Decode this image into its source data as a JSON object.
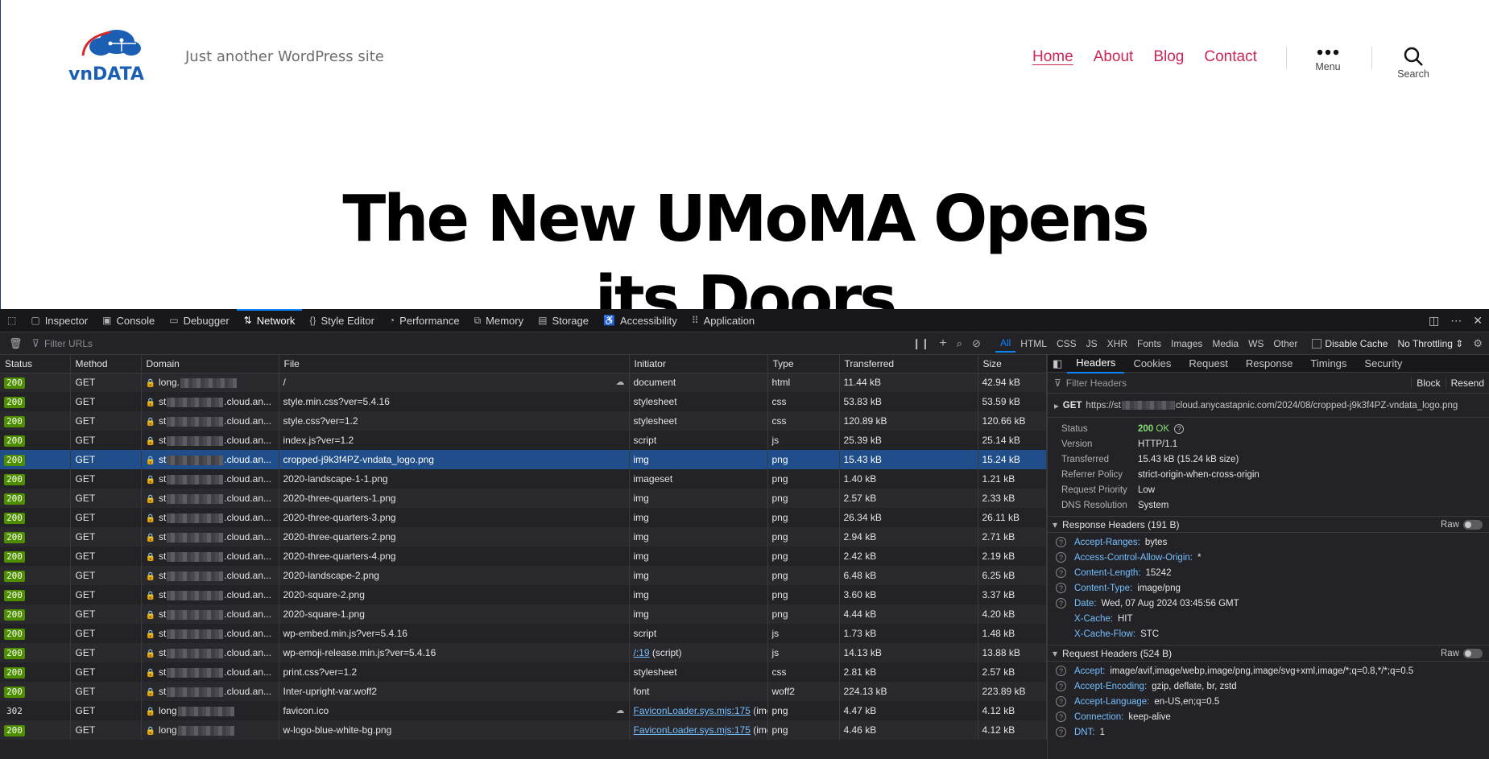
{
  "site": {
    "tagline": "Just another WordPress site",
    "logo_text": "vnDATA",
    "nav": [
      "Home",
      "About",
      "Blog",
      "Contact"
    ],
    "menu_label": "Menu",
    "search_label": "Search",
    "headline": "The New UMoMA Opens its Doors",
    "colors": {
      "accent": "#cd2653",
      "logo_blue": "#1a5fb4",
      "logo_red": "#d42a2a"
    }
  },
  "devtools": {
    "tabs": [
      {
        "label": "Inspector",
        "icon": "inspector-icon"
      },
      {
        "label": "Console",
        "icon": "console-icon"
      },
      {
        "label": "Debugger",
        "icon": "debugger-icon"
      },
      {
        "label": "Network",
        "icon": "network-icon"
      },
      {
        "label": "Style Editor",
        "icon": "style-editor-icon"
      },
      {
        "label": "Performance",
        "icon": "performance-icon"
      },
      {
        "label": "Memory",
        "icon": "memory-icon"
      },
      {
        "label": "Storage",
        "icon": "storage-icon"
      },
      {
        "label": "Accessibility",
        "icon": "accessibility-icon"
      },
      {
        "label": "Application",
        "icon": "application-icon"
      }
    ],
    "filter_placeholder": "Filter URLs",
    "type_filters": [
      "All",
      "HTML",
      "CSS",
      "JS",
      "XHR",
      "Fonts",
      "Images",
      "Media",
      "WS",
      "Other"
    ],
    "disable_cache": "Disable Cache",
    "throttling": "No Throttling ⇕",
    "columns": [
      "Status",
      "Method",
      "Domain",
      "File",
      "Initiator",
      "Type",
      "Transferred",
      "Size"
    ],
    "rows": [
      {
        "status": "200",
        "method": "GET",
        "domain_pre": "long.",
        "domain_post": "",
        "file": "/",
        "initiator": "document",
        "type": "html",
        "transferred": "11.44 kB",
        "size": "42.94 kB"
      },
      {
        "status": "200",
        "method": "GET",
        "domain_pre": "st",
        "domain_post": ".cloud.an...",
        "file": "style.min.css?ver=5.4.16",
        "initiator": "stylesheet",
        "type": "css",
        "transferred": "53.83 kB",
        "size": "53.59 kB"
      },
      {
        "status": "200",
        "method": "GET",
        "domain_pre": "st",
        "domain_post": ".cloud.an...",
        "file": "style.css?ver=1.2",
        "initiator": "stylesheet",
        "type": "css",
        "transferred": "120.89 kB",
        "size": "120.66 kB"
      },
      {
        "status": "200",
        "method": "GET",
        "domain_pre": "st",
        "domain_post": ".cloud.an...",
        "file": "index.js?ver=1.2",
        "initiator": "script",
        "type": "js",
        "transferred": "25.39 kB",
        "size": "25.14 kB"
      },
      {
        "status": "200",
        "method": "GET",
        "domain_pre": "st",
        "domain_post": ".cloud.an...",
        "file": "cropped-j9k3f4PZ-vndata_logo.png",
        "initiator": "img",
        "type": "png",
        "transferred": "15.43 kB",
        "size": "15.24 kB"
      },
      {
        "status": "200",
        "method": "GET",
        "domain_pre": "st",
        "domain_post": ".cloud.an...",
        "file": "2020-landscape-1-1.png",
        "initiator": "imageset",
        "type": "png",
        "transferred": "1.40 kB",
        "size": "1.21 kB"
      },
      {
        "status": "200",
        "method": "GET",
        "domain_pre": "st",
        "domain_post": ".cloud.an...",
        "file": "2020-three-quarters-1.png",
        "initiator": "img",
        "type": "png",
        "transferred": "2.57 kB",
        "size": "2.33 kB"
      },
      {
        "status": "200",
        "method": "GET",
        "domain_pre": "st",
        "domain_post": ".cloud.an...",
        "file": "2020-three-quarters-3.png",
        "initiator": "img",
        "type": "png",
        "transferred": "26.34 kB",
        "size": "26.11 kB"
      },
      {
        "status": "200",
        "method": "GET",
        "domain_pre": "st",
        "domain_post": ".cloud.an...",
        "file": "2020-three-quarters-2.png",
        "initiator": "img",
        "type": "png",
        "transferred": "2.94 kB",
        "size": "2.71 kB"
      },
      {
        "status": "200",
        "method": "GET",
        "domain_pre": "st",
        "domain_post": ".cloud.an...",
        "file": "2020-three-quarters-4.png",
        "initiator": "img",
        "type": "png",
        "transferred": "2.42 kB",
        "size": "2.19 kB"
      },
      {
        "status": "200",
        "method": "GET",
        "domain_pre": "st",
        "domain_post": ".cloud.an...",
        "file": "2020-landscape-2.png",
        "initiator": "img",
        "type": "png",
        "transferred": "6.48 kB",
        "size": "6.25 kB"
      },
      {
        "status": "200",
        "method": "GET",
        "domain_pre": "st",
        "domain_post": ".cloud.an...",
        "file": "2020-square-2.png",
        "initiator": "img",
        "type": "png",
        "transferred": "3.60 kB",
        "size": "3.37 kB"
      },
      {
        "status": "200",
        "method": "GET",
        "domain_pre": "st",
        "domain_post": ".cloud.an...",
        "file": "2020-square-1.png",
        "initiator": "img",
        "type": "png",
        "transferred": "4.44 kB",
        "size": "4.20 kB"
      },
      {
        "status": "200",
        "method": "GET",
        "domain_pre": "st",
        "domain_post": ".cloud.an...",
        "file": "wp-embed.min.js?ver=5.4.16",
        "initiator": "script",
        "type": "js",
        "transferred": "1.73 kB",
        "size": "1.48 kB"
      },
      {
        "status": "200",
        "method": "GET",
        "domain_pre": "st",
        "domain_post": ".cloud.an...",
        "file": "wp-emoji-release.min.js?ver=5.4.16",
        "initiator_link": "/:19",
        "initiator": " (script)",
        "type": "js",
        "transferred": "14.13 kB",
        "size": "13.88 kB"
      },
      {
        "status": "200",
        "method": "GET",
        "domain_pre": "st",
        "domain_post": ".cloud.an...",
        "file": "print.css?ver=1.2",
        "initiator": "stylesheet",
        "type": "css",
        "transferred": "2.81 kB",
        "size": "2.57 kB"
      },
      {
        "status": "200",
        "method": "GET",
        "domain_pre": "st",
        "domain_post": ".cloud.an...",
        "file": "Inter-upright-var.woff2",
        "initiator": "font",
        "type": "woff2",
        "transferred": "224.13 kB",
        "size": "223.89 kB"
      },
      {
        "status": "302",
        "method": "GET",
        "domain_pre": "long",
        "domain_post": "",
        "file": "favicon.ico",
        "initiator_link": "FaviconLoader.sys.mjs:175",
        "initiator": " (img)",
        "type": "png",
        "transferred": "4.47 kB",
        "size": "4.12 kB"
      },
      {
        "status": "200",
        "method": "GET",
        "domain_pre": "long",
        "domain_post": "",
        "file": "w-logo-blue-white-bg.png",
        "initiator_link": "FaviconLoader.sys.mjs:175",
        "initiator": " (img)",
        "type": "png",
        "transferred": "4.46 kB",
        "size": "4.12 kB"
      }
    ],
    "side": {
      "tabs": [
        "Headers",
        "Cookies",
        "Request",
        "Response",
        "Timings",
        "Security"
      ],
      "filter_placeholder": "Filter Headers",
      "block": "Block",
      "resend": "Resend",
      "url_method": "GET",
      "url_pre": "https://st",
      "url_post": "cloud.anycastapnic.com/2024/08/cropped-j9k3f4PZ-vndata_logo.png",
      "status_code": "200",
      "status_text": "OK",
      "summary": [
        {
          "k": "Version",
          "v": "HTTP/1.1"
        },
        {
          "k": "Transferred",
          "v": "15.43 kB (15.24 kB size)"
        },
        {
          "k": "Referrer Policy",
          "v": "strict-origin-when-cross-origin"
        },
        {
          "k": "Request Priority",
          "v": "Low"
        },
        {
          "k": "DNS Resolution",
          "v": "System"
        }
      ],
      "status_label": "Status",
      "response_headers_title": "Response Headers (191 B)",
      "raw": "Raw",
      "response_headers": [
        {
          "k": "Accept-Ranges:",
          "v": "bytes",
          "q": true
        },
        {
          "k": "Access-Control-Allow-Origin:",
          "v": "*",
          "q": true
        },
        {
          "k": "Content-Length:",
          "v": "15242",
          "q": true
        },
        {
          "k": "Content-Type:",
          "v": "image/png",
          "q": true
        },
        {
          "k": "Date:",
          "v": "Wed, 07 Aug 2024 03:45:56 GMT",
          "q": true
        },
        {
          "k": "X-Cache:",
          "v": "HIT",
          "q": false
        },
        {
          "k": "X-Cache-Flow:",
          "v": "STC",
          "q": false
        }
      ],
      "request_headers_title": "Request Headers (524 B)",
      "request_headers": [
        {
          "k": "Accept:",
          "v": "image/avif,image/webp,image/png,image/svg+xml,image/*;q=0.8,*/*;q=0.5",
          "q": true
        },
        {
          "k": "Accept-Encoding:",
          "v": "gzip, deflate, br, zstd",
          "q": true
        },
        {
          "k": "Accept-Language:",
          "v": "en-US,en;q=0.5",
          "q": true
        },
        {
          "k": "Connection:",
          "v": "keep-alive",
          "q": true
        },
        {
          "k": "DNT:",
          "v": "1",
          "q": true
        }
      ]
    }
  }
}
